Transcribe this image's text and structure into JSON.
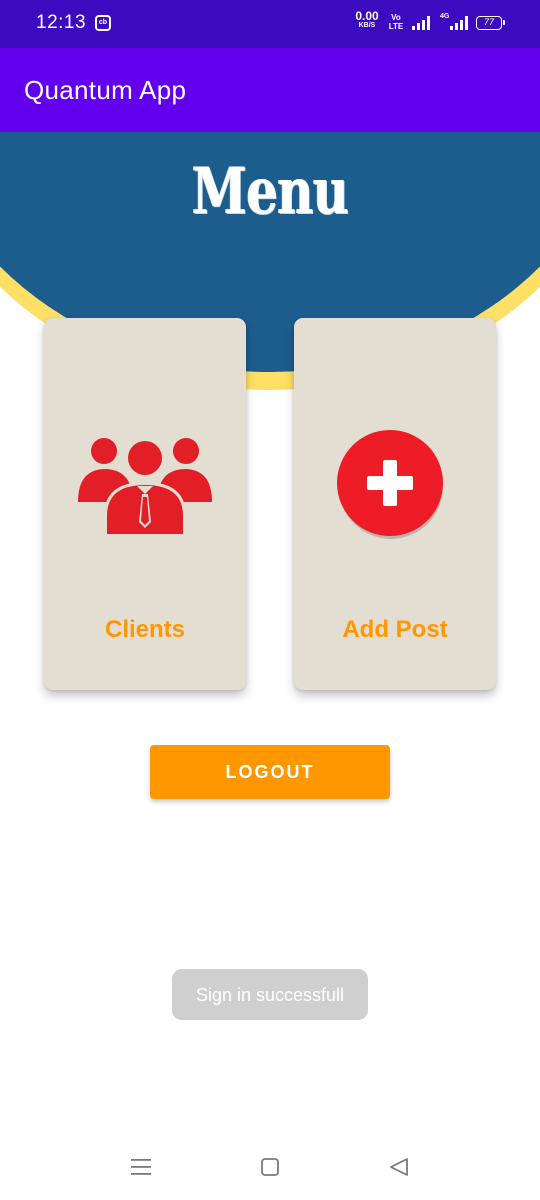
{
  "status_bar": {
    "time": "12:13",
    "notification_badge": "cb",
    "net_speed_value": "0.00",
    "net_speed_unit": "KB/S",
    "volte_top": "Vo",
    "volte_bottom": "LTE",
    "network_type": "4G",
    "battery_level": "77",
    "background_color": "#3d0bbf"
  },
  "app_bar": {
    "title": "Quantum App",
    "background_color": "#6200ee"
  },
  "header": {
    "title": "Menu",
    "background_color": "#1c5d8e",
    "accent_color": "#ffe066"
  },
  "cards": {
    "clients": {
      "label": "Clients",
      "icon": "group-users-icon"
    },
    "add_post": {
      "label": "Add Post",
      "icon": "plus-circle-icon"
    },
    "background_color": "#e4ddd2",
    "label_color": "#ff9800",
    "icon_color": "#e21f26"
  },
  "logout": {
    "label": "LOGOUT",
    "background_color": "#ff9800"
  },
  "toast": {
    "message": "Sign in successfull"
  },
  "nav_bar": {
    "icons": [
      "menu-icon",
      "home-icon",
      "back-icon"
    ]
  }
}
